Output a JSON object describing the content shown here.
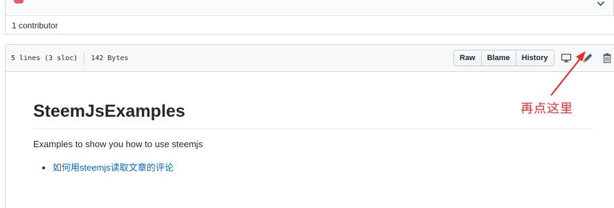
{
  "contributors": {
    "text": "1 contributor"
  },
  "file": {
    "lines": "5 lines (3 sloc)",
    "size": "142 Bytes",
    "buttons": {
      "raw": "Raw",
      "blame": "Blame",
      "history": "History"
    },
    "icons": [
      "desktop-icon",
      "pencil-icon",
      "trash-icon"
    ]
  },
  "readme": {
    "title": "SteemJsExamples",
    "paragraph": "Examples to show you how to use steemjs",
    "links": [
      "如何用steemjs读取文章的评论"
    ]
  },
  "annotation": {
    "text": "再点这里",
    "color": "#ef2b2b"
  },
  "colors": {
    "link": "#0366d6",
    "header_bg": "#f6f8fa",
    "border": "#d1d5da"
  }
}
